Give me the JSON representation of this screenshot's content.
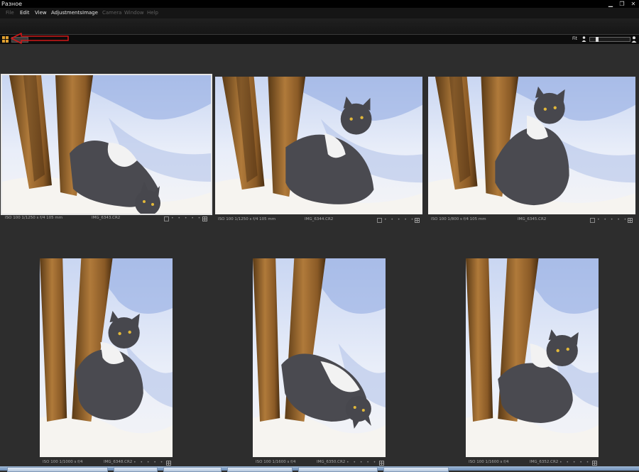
{
  "window": {
    "title": "Разное"
  },
  "menu": [
    {
      "label": "File",
      "enabled": false
    },
    {
      "label": "Edit",
      "enabled": true
    },
    {
      "label": "View",
      "enabled": true
    },
    {
      "label": "Adjustments",
      "enabled": true
    },
    {
      "label": "Image",
      "enabled": true
    },
    {
      "label": "Camera",
      "enabled": false
    },
    {
      "label": "Window",
      "enabled": false
    },
    {
      "label": "Help",
      "enabled": false
    }
  ],
  "viewbar": {
    "fit_label": "Fit"
  },
  "thumbnails": [
    {
      "meta": "ISO 100  1/1250 s  f/4  105 mm",
      "filename": "IMG_6343.CR2",
      "rating": "• • • • •",
      "selected": true
    },
    {
      "meta": "ISO 100  1/1250 s  f/4  105 mm",
      "filename": "IMG_6344.CR2",
      "rating": "• • • • •",
      "selected": false
    },
    {
      "meta": "ISO 100  1/800 s  f/4  105 mm",
      "filename": "IMG_6345.CR2",
      "rating": "• • • • •",
      "selected": false
    },
    {
      "meta": "ISO 100  1/1000 s  f/4",
      "filename": "IMG_6348.CR2",
      "rating": "• • • • •",
      "selected": false
    },
    {
      "meta": "ISO 100  1/1600 s  f/4",
      "filename": "IMG_6350.CR2",
      "rating": "• • • • •",
      "selected": false
    },
    {
      "meta": "ISO 100  1/1600 s  f/4",
      "filename": "IMG_6352.CR2",
      "rating": "• • • • •",
      "selected": false
    }
  ],
  "colors": {
    "accent_orange": "#e0a030",
    "annotation_red": "#d01818",
    "selection": "#e6e6e6"
  }
}
